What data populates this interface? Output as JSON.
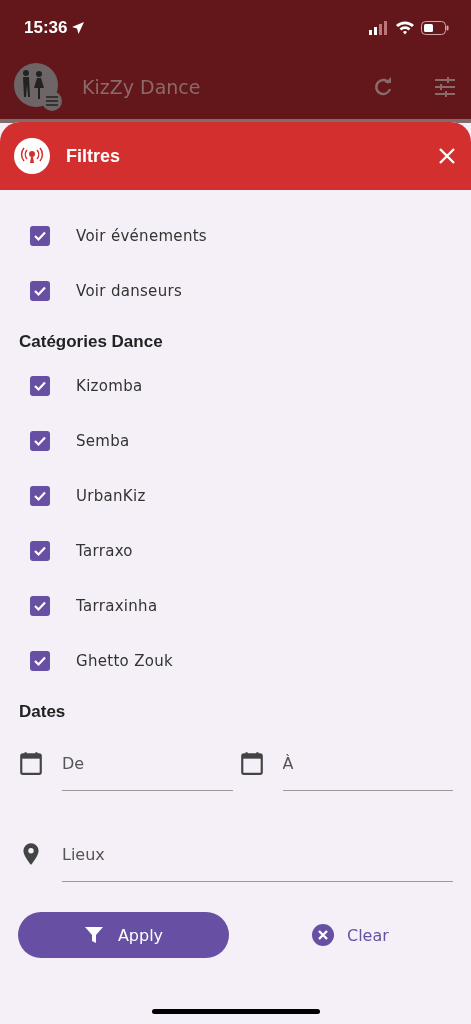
{
  "status_bar": {
    "time": "15:36"
  },
  "app_bar": {
    "title": "KizZy Dance"
  },
  "sheet": {
    "title": "Filtres"
  },
  "toggles": [
    {
      "label": "Voir événements",
      "checked": true
    },
    {
      "label": "Voir danseurs",
      "checked": true
    }
  ],
  "categories": {
    "title": "Catégories Dance",
    "items": [
      {
        "label": "Kizomba",
        "checked": true
      },
      {
        "label": "Semba",
        "checked": true
      },
      {
        "label": "UrbanKiz",
        "checked": true
      },
      {
        "label": "Tarraxo",
        "checked": true
      },
      {
        "label": "Tarraxinha",
        "checked": true
      },
      {
        "label": "Ghetto Zouk",
        "checked": true
      }
    ]
  },
  "dates": {
    "title": "Dates",
    "from": {
      "placeholder": "De"
    },
    "to": {
      "placeholder": "À"
    }
  },
  "place": {
    "placeholder": "Lieux"
  },
  "buttons": {
    "apply": "Apply",
    "clear": "Clear"
  }
}
